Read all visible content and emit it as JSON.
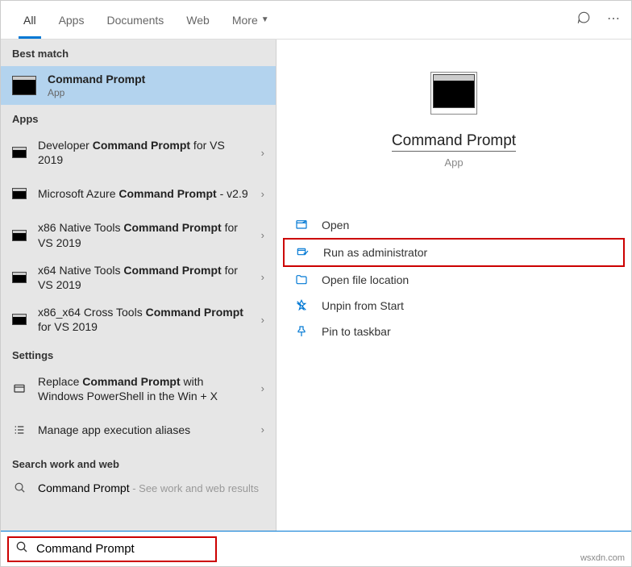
{
  "tabs": {
    "all": "All",
    "apps": "Apps",
    "documents": "Documents",
    "web": "Web",
    "more": "More"
  },
  "sections": {
    "best_match": "Best match",
    "apps": "Apps",
    "settings": "Settings",
    "web": "Search work and web"
  },
  "best_match": {
    "title": "Command Prompt",
    "subtitle": "App"
  },
  "apps": [
    {
      "pre": "Developer ",
      "bold": "Command Prompt",
      "post": " for VS 2019"
    },
    {
      "pre": "Microsoft Azure ",
      "bold": "Command Prompt",
      "post": " - v2.9"
    },
    {
      "pre": "x86 Native Tools ",
      "bold": "Command Prompt",
      "post": " for VS 2019"
    },
    {
      "pre": "x64 Native Tools ",
      "bold": "Command Prompt",
      "post": " for VS 2019"
    },
    {
      "pre": "x86_x64 Cross Tools ",
      "bold": "Command Prompt",
      "post": " for VS 2019"
    }
  ],
  "settings_items": [
    {
      "pre": "Replace ",
      "bold": "Command Prompt",
      "post": " with Windows PowerShell in the Win + X",
      "icon": "replace"
    },
    {
      "pre": "Manage app execution aliases",
      "bold": "",
      "post": "",
      "icon": "aliases"
    }
  ],
  "web_item": {
    "title": "Command Prompt",
    "sub": " - See work and web results"
  },
  "search": {
    "value": "Command Prompt"
  },
  "detail": {
    "title": "Command Prompt",
    "subtitle": "App"
  },
  "actions": {
    "open": "Open",
    "run_admin": "Run as administrator",
    "open_location": "Open file location",
    "unpin_start": "Unpin from Start",
    "pin_taskbar": "Pin to taskbar"
  },
  "watermark": "wsxdn.com"
}
